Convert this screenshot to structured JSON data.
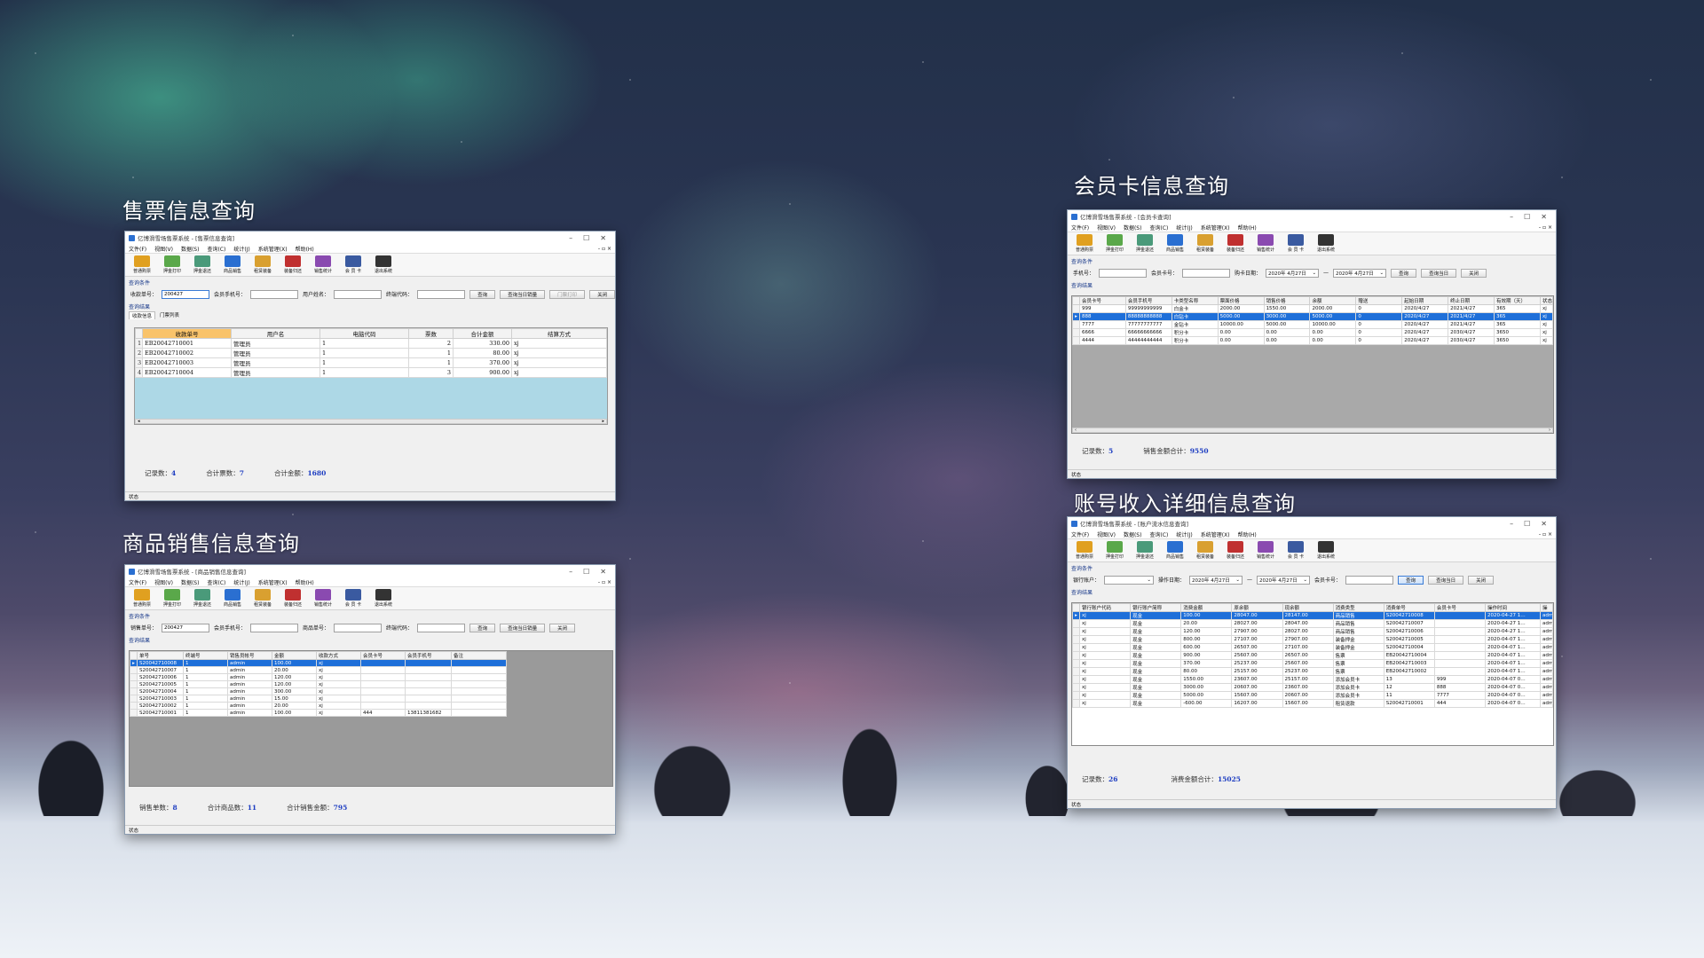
{
  "titles": {
    "ticket": "售票信息查询",
    "product": "商品销售信息查询",
    "member": "会员卡信息查询",
    "account": "账号收入详细信息查询"
  },
  "common": {
    "menu": [
      "文件(F)",
      "视图(V)",
      "数据(S)",
      "查询(C)",
      "统计(J)",
      "系统管理(X)",
      "帮助(H)"
    ],
    "tools": [
      {
        "label": "普通购票",
        "icon": "ticket-icon",
        "color": "#e0a020"
      },
      {
        "label": "押金打印",
        "icon": "print-icon",
        "color": "#5aa84a"
      },
      {
        "label": "押金退还",
        "icon": "refund-icon",
        "color": "#4a9a7a"
      },
      {
        "label": "商品销售",
        "icon": "shop-icon",
        "color": "#2a6fd1"
      },
      {
        "label": "租赁装备",
        "icon": "equipment-icon",
        "color": "#d9a030"
      },
      {
        "label": "装备归还",
        "icon": "return-icon",
        "color": "#c03030"
      },
      {
        "label": "销售统计",
        "icon": "stats-icon",
        "color": "#8a4ab0"
      },
      {
        "label": "会 员 卡",
        "icon": "member-card-icon",
        "color": "#3a5aa0"
      },
      {
        "label": "退出系统",
        "icon": "exit-icon",
        "color": "#333333"
      }
    ],
    "status": "状态",
    "cond_label": "查询条件",
    "result_label": "查询结果",
    "close": "关闭",
    "query": "查询",
    "today": "查询当日",
    "today_detail": "查询当日销量",
    "mdi_controls": "- ▫ ×"
  },
  "ticket": {
    "window_title": "亿博滑雪场售票系统 - [售票信息查询]",
    "fields": {
      "order_label": "收款单号：",
      "order_value": "200427",
      "phone_label": "会员手机号：",
      "user_label": "用户姓名：",
      "terminal_label": "终端代码："
    },
    "buttons": [
      "查询",
      "查询当日销量",
      "门票打印",
      "关闭"
    ],
    "tabs": [
      "收款信息",
      "门票列表"
    ],
    "columns": [
      "收款单号",
      "用户名",
      "电脑代码",
      "票数",
      "合计金额",
      "结算方式"
    ],
    "rows": [
      [
        "1",
        "EB20042710001",
        "管理员",
        "1",
        "2",
        "330.00",
        "xj"
      ],
      [
        "2",
        "EB20042710002",
        "管理员",
        "1",
        "1",
        "80.00",
        "xj"
      ],
      [
        "3",
        "EB20042710003",
        "管理员",
        "1",
        "1",
        "370.00",
        "xj"
      ],
      [
        "4",
        "EB20042710004",
        "管理员",
        "1",
        "3",
        "900.00",
        "xj"
      ]
    ],
    "summary": [
      {
        "label": "记录数：",
        "value": "4"
      },
      {
        "label": "合计票数：",
        "value": "7"
      },
      {
        "label": "合计金额：",
        "value": "1680"
      }
    ]
  },
  "product": {
    "window_title": "亿博滑雪场售票系统 - [商品销售信息查询]",
    "fields": {
      "order_label": "销售单号：",
      "order_value": "200427",
      "phone_label": "会员手机号：",
      "goods_label": "商品单号：",
      "terminal_label": "终端代码："
    },
    "buttons": [
      "查询",
      "查询当日销量",
      "关闭"
    ],
    "columns": [
      "单号",
      "终端号",
      "销售员帐号",
      "金额",
      "收款方式",
      "会员卡号",
      "会员手机号",
      "备注"
    ],
    "rows": [
      [
        "▸",
        "S20042710008",
        "1",
        "admin",
        "100.00",
        "xj",
        "",
        "",
        ""
      ],
      [
        "",
        "S20042710007",
        "1",
        "admin",
        "20.00",
        "xj",
        "",
        "",
        ""
      ],
      [
        "",
        "S20042710006",
        "1",
        "admin",
        "120.00",
        "xj",
        "",
        "",
        ""
      ],
      [
        "",
        "S20042710005",
        "1",
        "admin",
        "120.00",
        "xj",
        "",
        "",
        ""
      ],
      [
        "",
        "S20042710004",
        "1",
        "admin",
        "300.00",
        "xj",
        "",
        "",
        ""
      ],
      [
        "",
        "S20042710003",
        "1",
        "admin",
        "15.00",
        "xj",
        "",
        "",
        ""
      ],
      [
        "",
        "S20042710002",
        "1",
        "admin",
        "20.00",
        "xj",
        "",
        "",
        ""
      ],
      [
        "",
        "S20042710001",
        "1",
        "admin",
        "100.00",
        "xj",
        "444",
        "13811381682",
        ""
      ]
    ],
    "summary": [
      {
        "label": "销售单数：",
        "value": "8"
      },
      {
        "label": "合计商品数：",
        "value": "11"
      },
      {
        "label": "合计销售金额：",
        "value": "795"
      }
    ]
  },
  "member": {
    "window_title": "亿博滑雪场售票系统 - [会员卡查询]",
    "fields": {
      "phone_label": "手机号：",
      "card_label": "会员卡号：",
      "date_label": "购卡日期：",
      "date_from": "2020年 4月27日",
      "date_sep": "—",
      "date_to": "2020年 4月27日"
    },
    "buttons": [
      "查询",
      "查询当日",
      "关闭"
    ],
    "columns": [
      "会员卡号",
      "会员手机号",
      "卡类型名称",
      "票面价格",
      "销售价格",
      "余额",
      "赠送",
      "起始日期",
      "终止日期",
      "有效期（天）",
      "状态"
    ],
    "rows": [
      [
        "",
        "999",
        "99999999999",
        "白金卡",
        "2000.00",
        "1550.00",
        "2000.00",
        "0",
        "2020/4/27",
        "2021/4/27",
        "365",
        "xj"
      ],
      [
        "▸",
        "888",
        "88888888888",
        "白钻卡",
        "5000.00",
        "3000.00",
        "5000.00",
        "0",
        "2020/4/27",
        "2021/4/27",
        "365",
        "xj"
      ],
      [
        "",
        "7777",
        "77777777777",
        "金钻卡",
        "10000.00",
        "5000.00",
        "10000.00",
        "0",
        "2020/4/27",
        "2021/4/27",
        "365",
        "xj"
      ],
      [
        "",
        "6666",
        "66666666666",
        "积分卡",
        "0.00",
        "0.00",
        "0.00",
        "0",
        "2020/4/27",
        "2030/4/27",
        "3650",
        "xj"
      ],
      [
        "",
        "4444",
        "44444444444",
        "积分卡",
        "0.00",
        "0.00",
        "0.00",
        "0",
        "2020/4/27",
        "2030/4/27",
        "3650",
        "xj"
      ]
    ],
    "summary": [
      {
        "label": "记录数：",
        "value": "5"
      },
      {
        "label": "销售金额合计：",
        "value": "9550"
      }
    ]
  },
  "account": {
    "window_title": "亿博滑雪场售票系统 - [账户流水信息查询]",
    "fields": {
      "bank_label": "银行账户：",
      "date_label": "操作日期：",
      "date_from": "2020年 4月27日",
      "date_sep": "—",
      "date_to": "2020年 4月27日",
      "card_label": "会员卡号："
    },
    "buttons": [
      "查询",
      "查询当日",
      "关闭"
    ],
    "columns": [
      "银行账户代码",
      "银行账户简称",
      "消费金额",
      "原余额",
      "现余额",
      "消费类型",
      "消费单号",
      "会员卡号",
      "操作时间",
      "操"
    ],
    "rows": [
      [
        "▸",
        "xj",
        "现金",
        "100.00",
        "28047.00",
        "28147.00",
        "商品销售",
        "S20042710008",
        "",
        "2020-04-27 1…",
        "adm"
      ],
      [
        "",
        "xj",
        "现金",
        "20.00",
        "28027.00",
        "28047.00",
        "商品销售",
        "S20042710007",
        "",
        "2020-04-27 1…",
        "adm"
      ],
      [
        "",
        "xj",
        "现金",
        "120.00",
        "27907.00",
        "28027.00",
        "商品销售",
        "S20042710006",
        "",
        "2020-04-27 1…",
        "adm"
      ],
      [
        "",
        "xj",
        "现金",
        "800.00",
        "27107.00",
        "27907.00",
        "装备押金",
        "S20042710005",
        "",
        "2020-04-07 1…",
        "adm"
      ],
      [
        "",
        "xj",
        "现金",
        "600.00",
        "26507.00",
        "27107.00",
        "装备押金",
        "S20042710004",
        "",
        "2020-04-07 1…",
        "adm"
      ],
      [
        "",
        "xj",
        "现金",
        "900.00",
        "25607.00",
        "26507.00",
        "售票",
        "EB20042710004",
        "",
        "2020-04-07 1…",
        "adm"
      ],
      [
        "",
        "xj",
        "现金",
        "370.00",
        "25237.00",
        "25607.00",
        "售票",
        "EB20042710003",
        "",
        "2020-04-07 1…",
        "adm"
      ],
      [
        "",
        "xj",
        "现金",
        "80.00",
        "25157.00",
        "25237.00",
        "售票",
        "EB20042710002",
        "",
        "2020-04-07 1…",
        "adm"
      ],
      [
        "",
        "xj",
        "现金",
        "1550.00",
        "23607.00",
        "25157.00",
        "添加会员卡",
        "13",
        "999",
        "2020-04-07 0…",
        "adm"
      ],
      [
        "",
        "xj",
        "现金",
        "3000.00",
        "20607.00",
        "23607.00",
        "添加会员卡",
        "12",
        "888",
        "2020-04-07 0…",
        "adm"
      ],
      [
        "",
        "xj",
        "现金",
        "5000.00",
        "15607.00",
        "20607.00",
        "添加会员卡",
        "11",
        "7777",
        "2020-04-07 0…",
        "adm"
      ],
      [
        "",
        "xj",
        "现金",
        "-600.00",
        "16207.00",
        "15607.00",
        "租赁退款",
        "S20042710001",
        "444",
        "2020-04-07 0…",
        "adm"
      ]
    ],
    "summary": [
      {
        "label": "记录数：",
        "value": "26"
      },
      {
        "label": "消费金额合计：",
        "value": "15025"
      }
    ]
  }
}
